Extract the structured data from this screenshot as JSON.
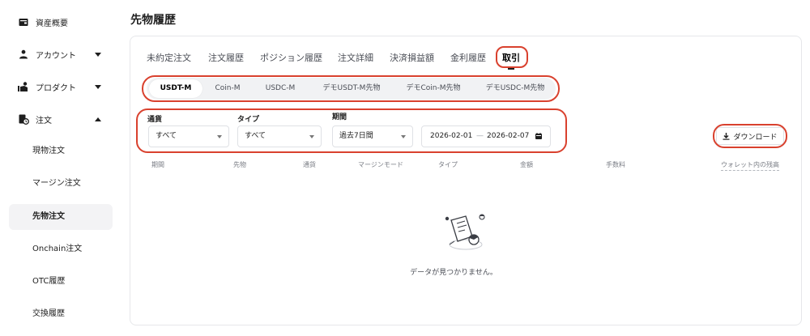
{
  "sidebar": {
    "items": [
      {
        "label": "資産概要",
        "icon": "wallet-icon"
      },
      {
        "label": "アカウント",
        "icon": "user-icon",
        "chevron": "down"
      },
      {
        "label": "プロダクト",
        "icon": "product-icon",
        "chevron": "down"
      },
      {
        "label": "注文",
        "icon": "order-icon",
        "chevron": "up"
      }
    ],
    "subitems": [
      "現物注文",
      "マージン注文",
      "先物注文",
      "Onchain注文",
      "OTC履歴",
      "交換履歴"
    ],
    "active_subitem": "先物注文"
  },
  "page": {
    "title": "先物履歴"
  },
  "tabs": [
    "未約定注文",
    "注文履歴",
    "ポジション履歴",
    "注文詳細",
    "決済損益額",
    "金利履歴",
    "取引"
  ],
  "active_tab": "取引",
  "segments": [
    "USDT-M",
    "Coin-M",
    "USDC-M",
    "デモUSDT-M先物",
    "デモCoin-M先物",
    "デモUSDC-M先物"
  ],
  "active_segment": "USDT-M",
  "filters": {
    "currency": {
      "label": "通貨",
      "value": "すべて"
    },
    "type": {
      "label": "タイプ",
      "value": "すべて"
    },
    "period": {
      "label": "期間",
      "value": "過去7日間"
    },
    "date_from": "2026-02-01",
    "date_sep": "—",
    "date_to": "2026-02-07"
  },
  "download_label": "ダウンロード",
  "columns": [
    "期間",
    "先物",
    "通貨",
    "マージンモード",
    "タイプ",
    "金額",
    "手数料",
    "ウォレット内の残高"
  ],
  "empty_text": "データが見つかりません。",
  "colors": {
    "highlight": "#d9412e",
    "panel_border": "#e6e7ea",
    "segment_bg": "#f1f2f4"
  }
}
